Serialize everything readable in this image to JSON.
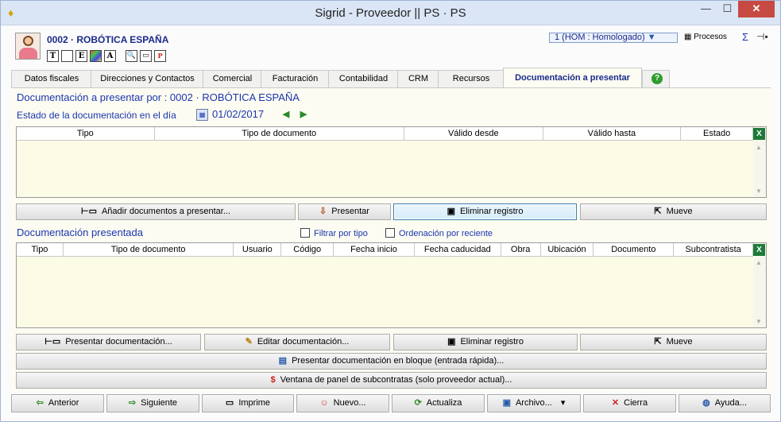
{
  "window": {
    "title": "Sigrid - Proveedor || PS · PS",
    "minimize": "—",
    "maximize": "☐",
    "close": "✕"
  },
  "header": {
    "company": "0002 · ROBÓTICA ESPAÑA",
    "status_select": "1 (HOM : Homologado)",
    "procesos": "Procesos",
    "format_icons": [
      "T",
      "",
      "E",
      "",
      "A"
    ]
  },
  "tabs": [
    "Datos fiscales",
    "Direcciones y Contactos",
    "Comercial",
    "Facturación",
    "Contabilidad",
    "CRM",
    "Recursos",
    "Documentación a presentar"
  ],
  "help": "?",
  "section1": {
    "title": "Documentación a presentar por : 0002 · ROBÓTICA ESPAÑA",
    "estado_label": "Estado de la documentación en el día",
    "date": "01/02/2017",
    "columns": [
      "Tipo",
      "Tipo de documento",
      "Válido desde",
      "Válido hasta",
      "Estado"
    ],
    "buttons": [
      "Añadir documentos a presentar...",
      "Presentar",
      "Eliminar registro",
      "Mueve"
    ]
  },
  "section2": {
    "title": "Documentación presentada",
    "filtrar": "Filtrar por tipo",
    "ordenacion": "Ordenación por reciente",
    "columns": [
      "Tipo",
      "Tipo de documento",
      "Usuario",
      "Código",
      "Fecha inicio",
      "Fecha caducidad",
      "Obra",
      "Ubicación",
      "Documento",
      "Subcontratista"
    ],
    "buttons": [
      "Presentar documentación...",
      "Editar documentación...",
      "Eliminar registro",
      "Mueve"
    ],
    "bloque": "Presentar documentación en bloque (entrada rápida)...",
    "panel": "Ventana de panel de subcontratas (solo proveedor actual)..."
  },
  "footer": [
    "Anterior",
    "Siguiente",
    "Imprime",
    "Nuevo...",
    "Actualiza",
    "Archivo...",
    "Cierra",
    "Ayuda..."
  ],
  "colors": {
    "accent_blue": "#1a36b0",
    "grid_bg": "#fbfbe6",
    "close_red": "#c74a42"
  }
}
